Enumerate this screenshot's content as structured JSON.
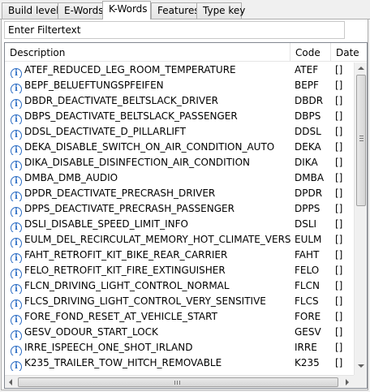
{
  "tabs": [
    {
      "label": "Build level",
      "active": false
    },
    {
      "label": "E-Words",
      "active": false
    },
    {
      "label": "K-Words",
      "active": true
    },
    {
      "label": "Features",
      "active": false
    },
    {
      "label": "Type key",
      "active": false
    }
  ],
  "filter": {
    "placeholder": "Enter Filtertext",
    "value": ""
  },
  "columns": {
    "description": "Description",
    "code": "Code",
    "date": "Date"
  },
  "icons": {
    "row_icon": "info-icon"
  },
  "rows": [
    {
      "description": "ATEF_REDUCED_LEG_ROOM_TEMPERATURE",
      "code": "ATEF",
      "date": "[]"
    },
    {
      "description": "BEPF_BELUEFTUNGSPFEIFEN",
      "code": "BEPF",
      "date": "[]"
    },
    {
      "description": "DBDR_DEACTIVATE_BELTSLACK_DRIVER",
      "code": "DBDR",
      "date": "[]"
    },
    {
      "description": "DBPS_DEACTIVATE_BELTSLACK_PASSENGER",
      "code": "DBPS",
      "date": "[]"
    },
    {
      "description": "DDSL_DEACTIVATE_D_PILLARLIFT",
      "code": "DDSL",
      "date": "[]"
    },
    {
      "description": "DEKA_DISABLE_SWITCH_ON_AIR_CONDITION_AUTO",
      "code": "DEKA",
      "date": "[]"
    },
    {
      "description": "DIKA_DISABLE_DISINFECTION_AIR_CONDITION",
      "code": "DIKA",
      "date": "[]"
    },
    {
      "description": "DMBA_DMB_AUDIO",
      "code": "DMBA",
      "date": "[]"
    },
    {
      "description": "DPDR_DEACTIVATE_PRECRASH_DRIVER",
      "code": "DPDR",
      "date": "[]"
    },
    {
      "description": "DPPS_DEACTIVATE_PRECRASH_PASSENGER",
      "code": "DPPS",
      "date": "[]"
    },
    {
      "description": "DSLI_DISABLE_SPEED_LIMIT_INFO",
      "code": "DSLI",
      "date": "[]"
    },
    {
      "description": "EULM_DEL_RECIRCULAT_MEMORY_HOT_CLIMATE_VERSION",
      "code": "EULM",
      "date": "[]"
    },
    {
      "description": "FAHT_RETROFIT_KIT_BIKE_REAR_CARRIER",
      "code": "FAHT",
      "date": "[]"
    },
    {
      "description": "FELO_RETROFIT_KIT_FIRE_EXTINGUISHER",
      "code": "FELO",
      "date": "[]"
    },
    {
      "description": "FLCN_DRIVING_LIGHT_CONTROL_NORMAL",
      "code": "FLCN",
      "date": "[]"
    },
    {
      "description": "FLCS_DRIVING_LIGHT_CONTROL_VERY_SENSITIVE",
      "code": "FLCS",
      "date": "[]"
    },
    {
      "description": "FORE_FOND_RESET_AT_VEHICLE_START",
      "code": "FORE",
      "date": "[]"
    },
    {
      "description": "GESV_ODOUR_START_LOCK",
      "code": "GESV",
      "date": "[]"
    },
    {
      "description": "IRRE_ISPEECH_ONE_SHOT_IRLAND",
      "code": "IRRE",
      "date": "[]"
    },
    {
      "description": "K235_TRAILER_TOW_HITCH_REMOVABLE",
      "code": "K235",
      "date": "[]"
    }
  ],
  "colors": {
    "icon": "#2a6cc4",
    "tab_border": "#adadad"
  }
}
